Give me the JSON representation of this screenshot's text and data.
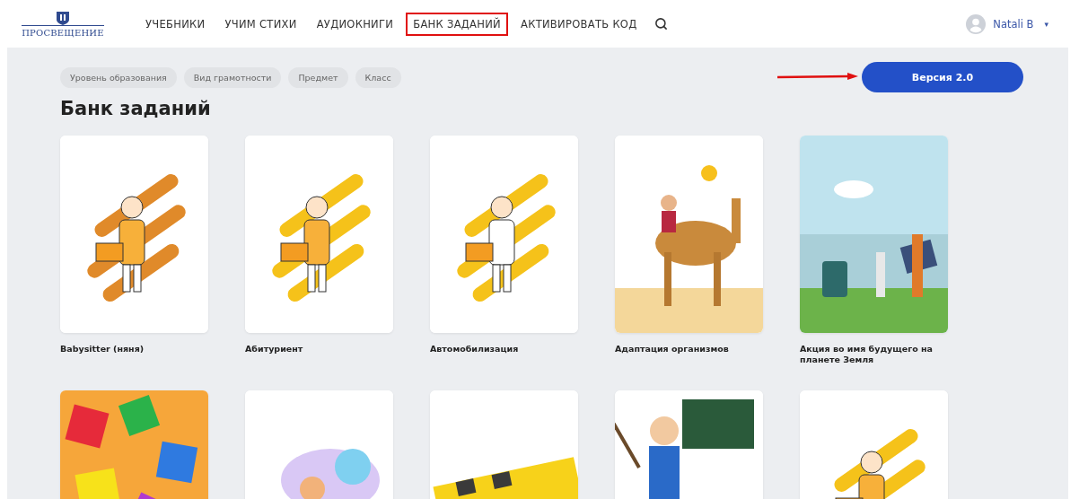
{
  "header": {
    "logo": "ПРОСВЕЩЕНИЕ",
    "nav": [
      {
        "label": "УЧЕБНИКИ",
        "selected": false
      },
      {
        "label": "УЧИМ СТИХИ",
        "selected": false
      },
      {
        "label": "АУДИОКНИГИ",
        "selected": false
      },
      {
        "label": "БАНК ЗАДАНИЙ",
        "selected": true
      },
      {
        "label": "АКТИВИРОВАТЬ КОД",
        "selected": false
      }
    ],
    "user": {
      "name": "Natali B",
      "caret": "▾"
    }
  },
  "filters": [
    "Уровень образования",
    "Вид грамотности",
    "Предмет",
    "Класс"
  ],
  "version_button": "Версия 2.0",
  "title": "Банк заданий",
  "cards": [
    {
      "title": "Babysitter (няня)",
      "kind": "picture"
    },
    {
      "title": "Абитуриент",
      "kind": "picture"
    },
    {
      "title": "Автомобилизация",
      "kind": "picture"
    },
    {
      "title": "Адаптация организмов",
      "kind": "picture"
    },
    {
      "title": "Акция во имя будущего на планете Земля",
      "kind": "picture"
    },
    {
      "kind": "picture"
    },
    {
      "kind": "picture"
    },
    {
      "kind": "picture"
    },
    {
      "kind": "picture"
    },
    {
      "kind": "picture"
    }
  ]
}
